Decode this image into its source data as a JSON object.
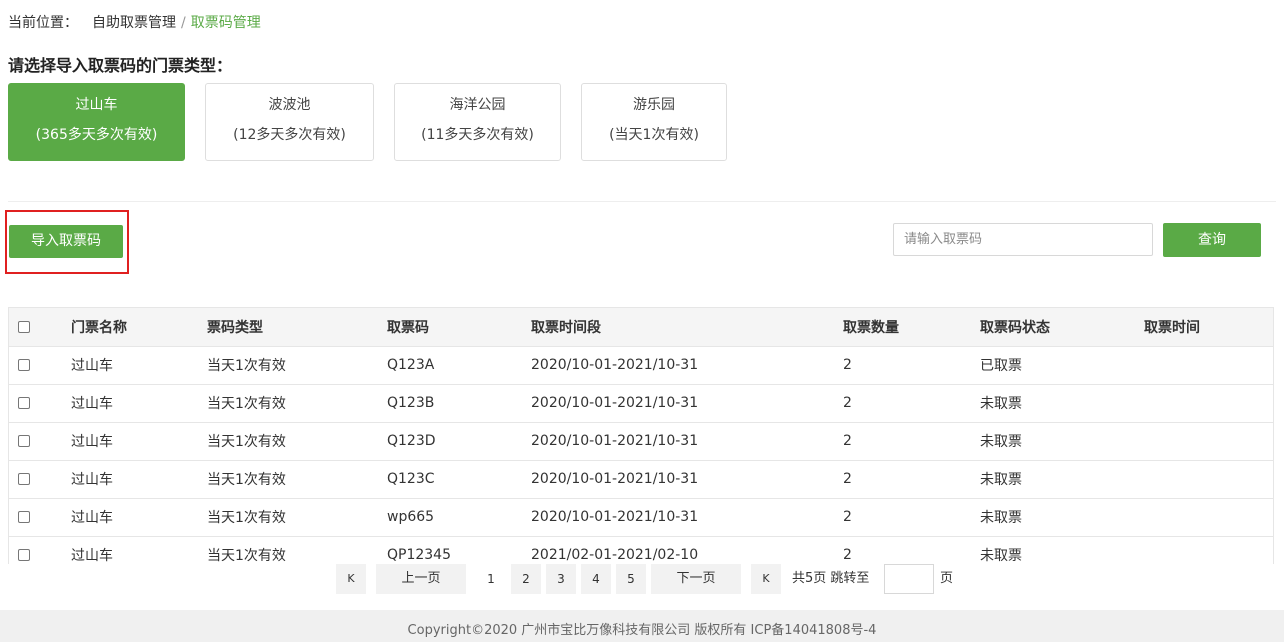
{
  "breadcrumb": {
    "prefix": "当前位置：",
    "home": "自助取票管理",
    "separator": "/",
    "current": "取票码管理"
  },
  "prompt": "请选择导入取票码的门票类型：",
  "ticket_types": [
    {
      "name": "过山车",
      "desc": "(365多天多次有效)",
      "active": true
    },
    {
      "name": "波波池",
      "desc": "(12多天多次有效)",
      "active": false
    },
    {
      "name": "海洋公园",
      "desc": "(11多天多次有效)",
      "active": false
    },
    {
      "name": "游乐园",
      "desc": "(当天1次有效)",
      "active": false
    }
  ],
  "toolbar": {
    "import_label": "导入取票码",
    "search_placeholder": "请输入取票码",
    "search_value": "",
    "query_label": "查询"
  },
  "table": {
    "headers": [
      "门票名称",
      "票码类型",
      "取票码",
      "取票时间段",
      "取票数量",
      "取票码状态",
      "取票时间"
    ],
    "rows": [
      {
        "name": "过山车",
        "type": "当天1次有效",
        "code": "Q123A",
        "period": "2020/10-01-2021/10-31",
        "qty": "2",
        "status": "已取票",
        "time": ""
      },
      {
        "name": "过山车",
        "type": "当天1次有效",
        "code": "Q123B",
        "period": "2020/10-01-2021/10-31",
        "qty": "2",
        "status": "未取票",
        "time": ""
      },
      {
        "name": "过山车",
        "type": "当天1次有效",
        "code": "Q123D",
        "period": "2020/10-01-2021/10-31",
        "qty": "2",
        "status": "未取票",
        "time": ""
      },
      {
        "name": "过山车",
        "type": "当天1次有效",
        "code": "Q123C",
        "period": "2020/10-01-2021/10-31",
        "qty": "2",
        "status": "未取票",
        "time": ""
      },
      {
        "name": "过山车",
        "type": "当天1次有效",
        "code": "wp665",
        "period": "2020/10-01-2021/10-31",
        "qty": "2",
        "status": "未取票",
        "time": ""
      },
      {
        "name": "过山车",
        "type": "当天1次有效",
        "code": "QP12345",
        "period": "2021/02-01-2021/02-10",
        "qty": "2",
        "status": "未取票",
        "time": ""
      }
    ]
  },
  "pagination": {
    "first_icon": "K",
    "prev_label": "上一页",
    "pages": [
      "1",
      "2",
      "3",
      "4",
      "5"
    ],
    "current_page": "1",
    "next_label": "下一页",
    "last_icon": "K",
    "total_text": "共5页 跳转至",
    "page_suffix": "页"
  },
  "footer": "Copyright©2020 广州市宝比万像科技有限公司 版权所有 ICP备14041808号-4",
  "colors": {
    "accent": "#5aaa46",
    "highlight": "#e02020"
  }
}
